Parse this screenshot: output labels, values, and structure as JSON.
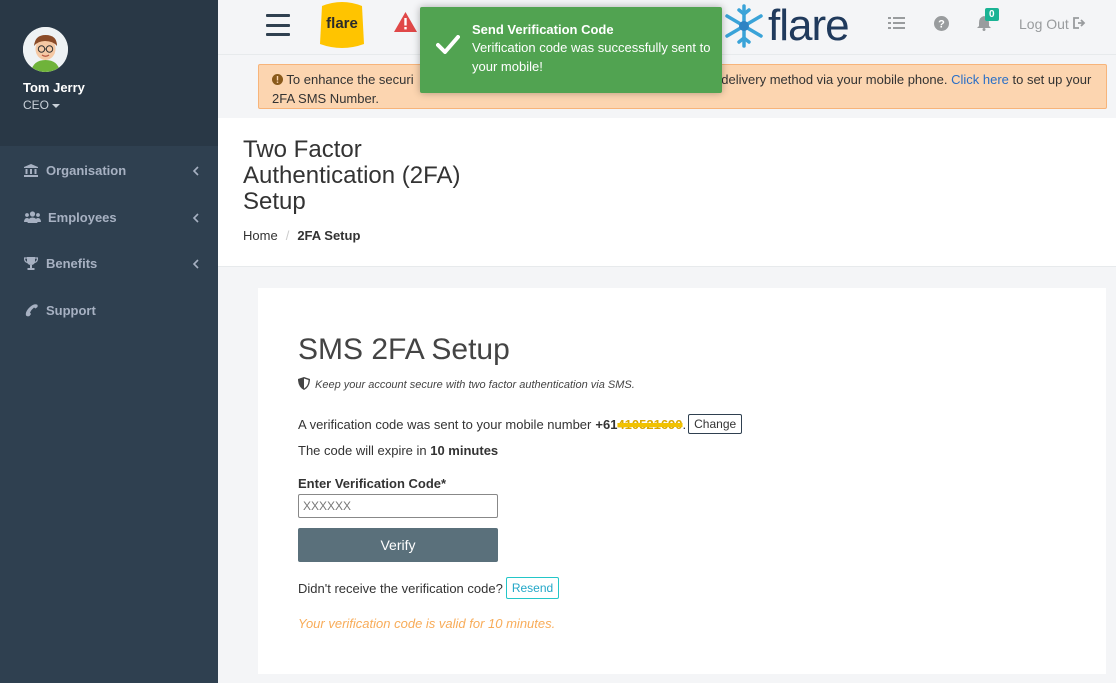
{
  "sidebar": {
    "profile": {
      "name": "Tom Jerry",
      "role": "CEO"
    },
    "items": [
      {
        "label": "Organisation",
        "icon": "bank-icon"
      },
      {
        "label": "Employees",
        "icon": "users-icon"
      },
      {
        "label": "Benefits",
        "icon": "trophy-icon"
      },
      {
        "label": "Support",
        "icon": "phone-icon"
      }
    ]
  },
  "topbar": {
    "logo_text": "flare",
    "brand_text": "flare",
    "notification_count": "0",
    "logout_label": "Log Out"
  },
  "banner": {
    "text_before": "To enhance the securi",
    "text_middle": "wo-Factor Authentication delivery method via your mobile phone.",
    "link_text": "Click here",
    "text_after": " to set up your 2FA SMS Number."
  },
  "toast": {
    "title": "Send Verification Code",
    "message": "Verification code was successfully sent to your mobile!"
  },
  "page": {
    "title": "Two Factor Authentication (2FA) Setup",
    "breadcrumb": {
      "home": "Home",
      "current": "2FA Setup"
    }
  },
  "card": {
    "title": "SMS 2FA Setup",
    "subtitle": "Keep your account secure with two factor authentication via SMS.",
    "sent_text": "A verification code was sent to your mobile number",
    "phone_prefix": "+61",
    "phone_redacted": "410521690",
    "period": ".",
    "change_label": "Change",
    "expire_text": "The code will expire in ",
    "expire_value": "10 minutes",
    "code_label": "Enter Verification Code*",
    "code_placeholder": "XXXXXX",
    "verify_label": "Verify",
    "resend_prompt": "Didn't receive the verification code?",
    "resend_label": "Resend",
    "valid_text": "Your verification code is valid for 10 minutes."
  },
  "colors": {
    "sidebar_bg": "#2f4050",
    "toast_bg": "#51a351",
    "banner_bg": "#fcd5b0",
    "verify_bg": "#5a707b",
    "valid_text": "#f8ac59"
  }
}
